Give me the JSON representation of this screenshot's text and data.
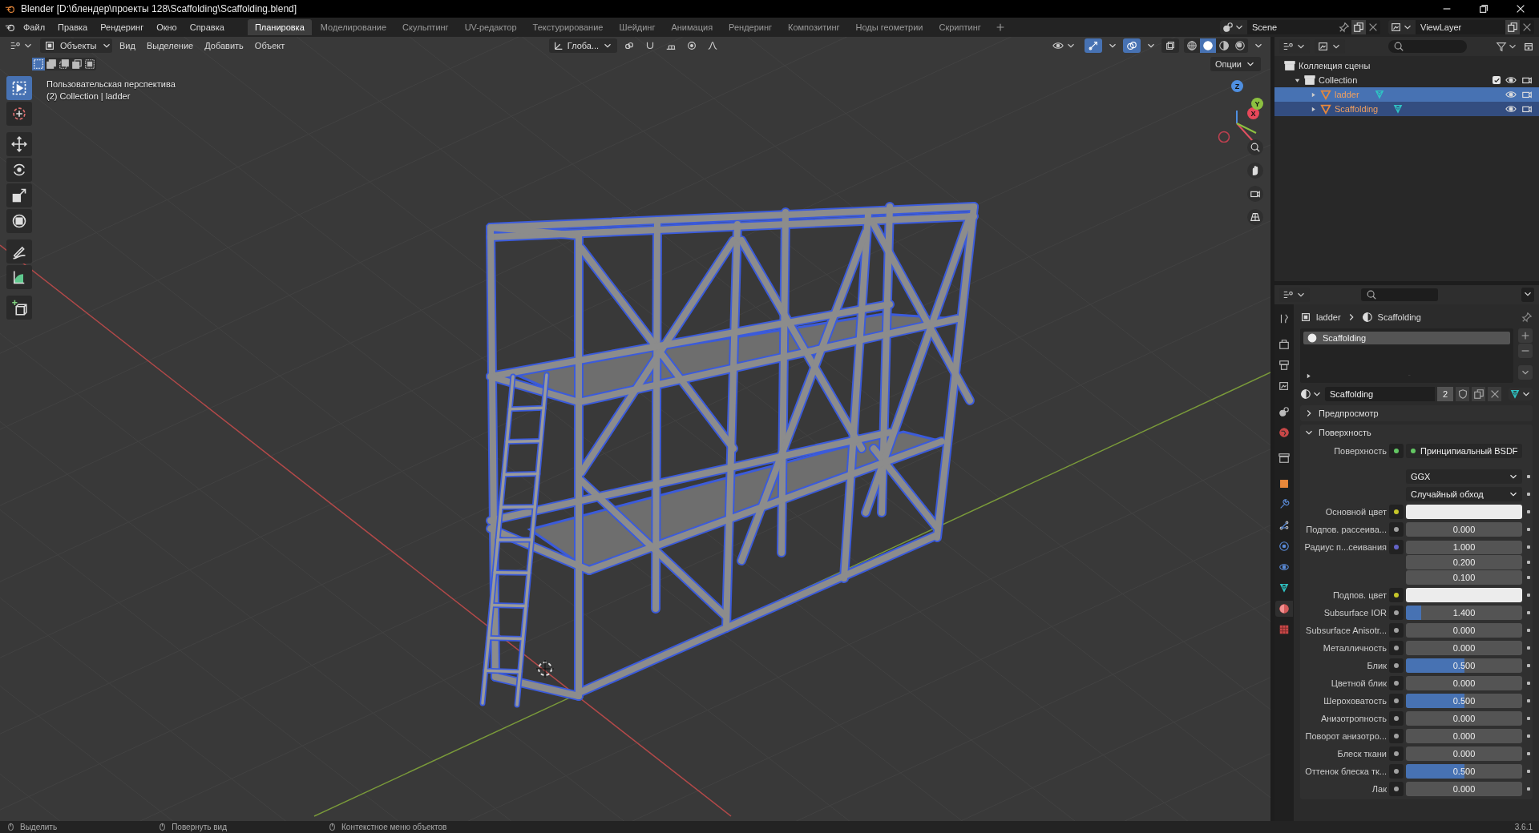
{
  "window": {
    "title": "Blender [D:\\блендер\\проекты 128\\Scaffolding\\Scaffolding.blend]"
  },
  "menu": [
    "Файл",
    "Правка",
    "Рендеринг",
    "Окно",
    "Справка"
  ],
  "workspaces": [
    {
      "label": "Планировка",
      "selected": true
    },
    {
      "label": "Моделирование",
      "selected": false
    },
    {
      "label": "Скульптинг",
      "selected": false
    },
    {
      "label": "UV-редактор",
      "selected": false
    },
    {
      "label": "Текстурирование",
      "selected": false
    },
    {
      "label": "Шейдинг",
      "selected": false
    },
    {
      "label": "Анимация",
      "selected": false
    },
    {
      "label": "Рендеринг",
      "selected": false
    },
    {
      "label": "Композитинг",
      "selected": false
    },
    {
      "label": "Ноды геометрии",
      "selected": false
    },
    {
      "label": "Скриптинг",
      "selected": false
    }
  ],
  "scene": {
    "name": "Scene"
  },
  "view_layer": {
    "name": "ViewLayer"
  },
  "viewport": {
    "mode": "Объекты",
    "menus": [
      "Вид",
      "Выделение",
      "Добавить",
      "Объект"
    ],
    "orientation": "Глоба...",
    "gizmos_on": true,
    "overlays_on": true,
    "shading": [
      {
        "kind": "wireframe",
        "selected": false
      },
      {
        "kind": "solid",
        "selected": true
      },
      {
        "kind": "material",
        "selected": false
      },
      {
        "kind": "rendered",
        "selected": false
      }
    ],
    "options": "Опции",
    "select_modes": [
      {
        "kind": "new",
        "selected": true
      },
      {
        "kind": "extend",
        "selected": false
      },
      {
        "kind": "subtract",
        "selected": false
      },
      {
        "kind": "invert",
        "selected": false
      },
      {
        "kind": "intersect",
        "selected": false
      }
    ],
    "tools": [
      {
        "kind": "select",
        "selected": true
      },
      {
        "kind": "cursor",
        "selected": false
      },
      {
        "kind": "move",
        "selected": false
      },
      {
        "kind": "rotate",
        "selected": false
      },
      {
        "kind": "scale",
        "selected": false
      },
      {
        "kind": "transform",
        "selected": false
      },
      {
        "kind": "annotate",
        "selected": false
      },
      {
        "kind": "measure",
        "selected": false
      },
      {
        "kind": "add_cube",
        "selected": false
      }
    ],
    "overlay_text": [
      "Пользовательская перспектива",
      "(2) Collection | ladder"
    ],
    "gizmo_axes": [
      "X",
      "Y",
      "Z"
    ]
  },
  "outliner": {
    "root": "Коллекция сцены",
    "items": [
      {
        "name": "Collection",
        "expanded": true,
        "included": true,
        "children": [
          {
            "name": "ladder",
            "selected": true,
            "active": true,
            "expanded": false
          },
          {
            "name": "Scaffolding",
            "selected": true,
            "active": false,
            "expanded": false
          }
        ]
      }
    ]
  },
  "properties": {
    "tabs": [
      {
        "kind": "tool",
        "selected": false
      },
      {
        "kind": "render",
        "selected": false
      },
      {
        "kind": "output",
        "selected": false
      },
      {
        "kind": "view_layer",
        "selected": false
      },
      {
        "kind": "scene",
        "selected": false
      },
      {
        "kind": "world",
        "selected": false
      },
      {
        "kind": "collection",
        "selected": false
      },
      {
        "kind": "object",
        "selected": false
      },
      {
        "kind": "modifiers",
        "selected": false
      },
      {
        "kind": "particles",
        "selected": false
      },
      {
        "kind": "physics",
        "selected": false
      },
      {
        "kind": "constraints",
        "selected": false
      },
      {
        "kind": "data",
        "selected": false
      },
      {
        "kind": "material",
        "selected": true
      },
      {
        "kind": "texture",
        "selected": false
      }
    ],
    "breadcrumb": [
      "ladder",
      "Scaffolding"
    ],
    "slots": [
      {
        "name": "Scaffolding",
        "selected": true
      }
    ],
    "material": {
      "name": "Scaffolding",
      "users": "2"
    },
    "panels": [
      {
        "label": "Предпросмотр",
        "expanded": false
      },
      {
        "label": "Поверхность",
        "expanded": true,
        "fields": [
          {
            "kind": "shader",
            "label": "Поверхность",
            "socket": {
              "color": "#63c763"
            },
            "value": "Принципиальный BSDF"
          },
          {
            "kind": "dropdown",
            "value": "GGX"
          },
          {
            "kind": "dropdown",
            "value": "Случайный обход"
          },
          {
            "kind": "color",
            "label": "Основной цвет",
            "socket": {
              "color": "#c7c729"
            },
            "color": "#ececec"
          },
          {
            "kind": "number",
            "label": "Подпов. рассеива...",
            "socket": {
              "color": "#a1a1a1"
            },
            "value": "0.000",
            "level": 0
          },
          {
            "kind": "vector",
            "label": "Радиус п...сеивания",
            "socket": {
              "color": "#6363c7"
            },
            "values": [
              "1.000",
              "0.200",
              "0.100"
            ]
          },
          {
            "kind": "color",
            "label": "Подпов. цвет",
            "socket": {
              "color": "#c7c729"
            },
            "color": "#ececec"
          },
          {
            "kind": "number",
            "label": "Subsurface IOR",
            "socket": {
              "color": "#a1a1a1"
            },
            "value": "1.400",
            "level": 0.13
          },
          {
            "kind": "number",
            "label": "Subsurface Anisotr...",
            "socket": {
              "color": "#a1a1a1"
            },
            "value": "0.000",
            "level": 0
          },
          {
            "kind": "number",
            "label": "Металличность",
            "socket": {
              "color": "#a1a1a1"
            },
            "value": "0.000",
            "level": 0
          },
          {
            "kind": "number",
            "label": "Блик",
            "socket": {
              "color": "#a1a1a1"
            },
            "value": "0.500",
            "level": 0.5
          },
          {
            "kind": "number",
            "label": "Цветной блик",
            "socket": {
              "color": "#a1a1a1"
            },
            "value": "0.000",
            "level": 0
          },
          {
            "kind": "number",
            "label": "Шероховатость",
            "socket": {
              "color": "#a1a1a1"
            },
            "value": "0.500",
            "level": 0.5
          },
          {
            "kind": "number",
            "label": "Анизотропность",
            "socket": {
              "color": "#a1a1a1"
            },
            "value": "0.000",
            "level": 0
          },
          {
            "kind": "number",
            "label": "Поворот анизотро...",
            "socket": {
              "color": "#a1a1a1"
            },
            "value": "0.000",
            "level": 0
          },
          {
            "kind": "number",
            "label": "Блеск ткани",
            "socket": {
              "color": "#a1a1a1"
            },
            "value": "0.000",
            "level": 0
          },
          {
            "kind": "number",
            "label": "Оттенок блеска тк...",
            "socket": {
              "color": "#a1a1a1"
            },
            "value": "0.500",
            "level": 0.5
          },
          {
            "kind": "number",
            "label": "Лак",
            "socket": {
              "color": "#a1a1a1"
            },
            "value": "0.000",
            "level": 0
          }
        ]
      }
    ]
  },
  "status_bar": {
    "hints": [
      "Выделить",
      "Повернуть вид",
      "Контекстное меню объектов"
    ],
    "version": "3.6.1"
  }
}
